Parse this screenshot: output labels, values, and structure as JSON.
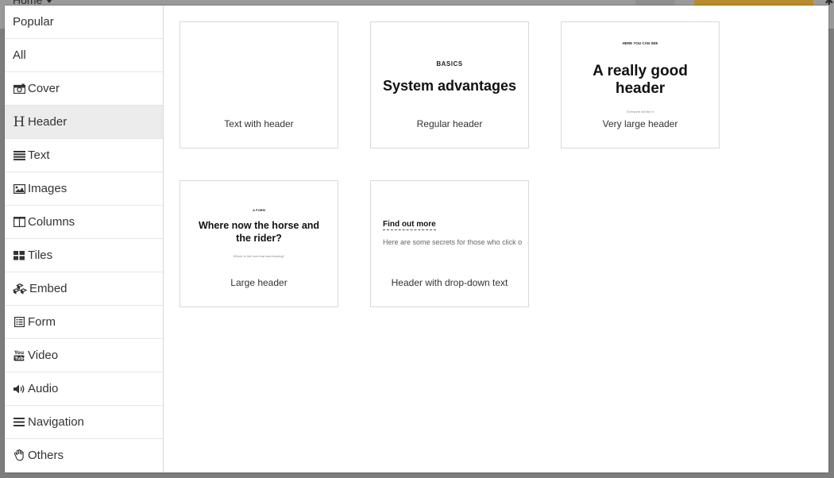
{
  "background": {
    "home_label": "Home"
  },
  "sidebar": {
    "items": [
      {
        "label": "Popular",
        "icon": ""
      },
      {
        "label": "All",
        "icon": ""
      },
      {
        "label": "Cover",
        "icon": "camera-icon"
      },
      {
        "label": "Header",
        "icon": "header-h-icon"
      },
      {
        "label": "Text",
        "icon": "align-justify-icon"
      },
      {
        "label": "Images",
        "icon": "image-icon"
      },
      {
        "label": "Columns",
        "icon": "columns-icon"
      },
      {
        "label": "Tiles",
        "icon": "tiles-icon"
      },
      {
        "label": "Embed",
        "icon": "cubes-icon"
      },
      {
        "label": "Form",
        "icon": "form-icon"
      },
      {
        "label": "Video",
        "icon": "youtube-icon"
      },
      {
        "label": "Audio",
        "icon": "volume-icon"
      },
      {
        "label": "Navigation",
        "icon": "bars-icon"
      },
      {
        "label": "Others",
        "icon": "hand-icon"
      }
    ],
    "active_index": 3
  },
  "cards": [
    {
      "label": "Text with header"
    },
    {
      "label": "Regular header",
      "preview": {
        "kicker": "BASICS",
        "title": "System advantages"
      }
    },
    {
      "label": "Very large header",
      "preview": {
        "kicker": "HERE YOU CAN SEE",
        "title_line1": "A really good",
        "title_line2": "header",
        "sub": "Everyone will like it"
      }
    },
    {
      "label": "Large header",
      "preview": {
        "kicker": "A POEM",
        "title_line1": "Where now the horse and",
        "title_line2": "the rider?",
        "sub": "Where is the horn that was blowing?"
      }
    },
    {
      "label": "Header with drop-down text",
      "preview": {
        "link": "Find out more",
        "secret": "Here are some secrets for those who click o"
      }
    }
  ],
  "colors": {
    "accent": "#b78a30",
    "active_bg": "#ececec",
    "border": "#d9d9d9"
  }
}
